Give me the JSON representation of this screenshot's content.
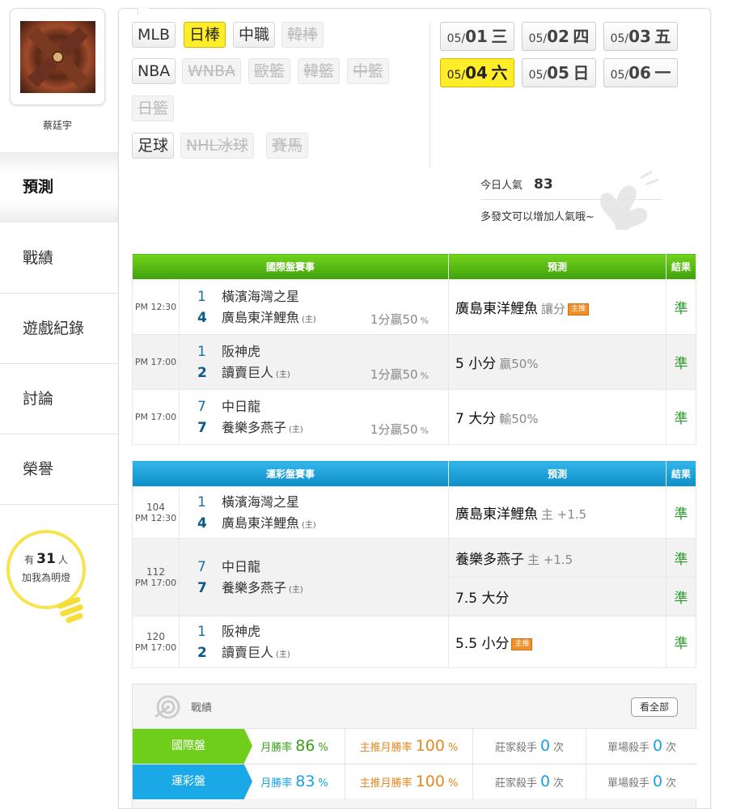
{
  "user": {
    "name": "蔡廷宇"
  },
  "nav": [
    {
      "label": "預測",
      "active": true
    },
    {
      "label": "戰績"
    },
    {
      "label": "遊戲紀錄"
    },
    {
      "label": "討論"
    },
    {
      "label": "榮譽"
    }
  ],
  "fans": {
    "prefix": "有",
    "count": "31",
    "suffix": "人",
    "cta": "加我為明燈"
  },
  "leagues": [
    {
      "label": "MLB"
    },
    {
      "label": "日棒",
      "state": "active"
    },
    {
      "label": "中職"
    },
    {
      "label": "韓棒",
      "state": "disabled"
    },
    {
      "label": "NBA"
    },
    {
      "label": "WNBA",
      "state": "disabled"
    },
    {
      "label": "歐籃",
      "state": "disabled"
    },
    {
      "label": "韓籃",
      "state": "disabled"
    },
    {
      "label": "中籃",
      "state": "disabled"
    },
    {
      "label": "日籃",
      "state": "disabled"
    },
    {
      "label": "足球"
    },
    {
      "label": "NHL冰球",
      "state": "disabled"
    },
    {
      "label": "賽馬",
      "state": "disabled"
    }
  ],
  "dates": [
    {
      "md": "05/",
      "d": "01",
      "wd": "三"
    },
    {
      "md": "05/",
      "d": "02",
      "wd": "四"
    },
    {
      "md": "05/",
      "d": "03",
      "wd": "五"
    },
    {
      "md": "05/",
      "d": "04",
      "wd": "六",
      "active": true
    },
    {
      "md": "05/",
      "d": "05",
      "wd": "日"
    },
    {
      "md": "05/",
      "d": "06",
      "wd": "一"
    }
  ],
  "popularity": {
    "label": "今日人氣",
    "value": "83",
    "message": "多發文可以增加人氣哦~"
  },
  "intl_table": {
    "headers": [
      "國際盤賽事",
      "預測",
      "結果"
    ],
    "rows": [
      {
        "time": "PM 12:30",
        "away": "橫濱海灣之星",
        "away_score": "1",
        "home": "廣島東洋鯉魚",
        "home_score": "4",
        "home_tag": "(主)",
        "odd": "1分贏50",
        "odd_unit": "%",
        "pred": "廣島東洋鯉魚",
        "pred_sub": "讓分",
        "pick": "主推",
        "result": "準"
      },
      {
        "time": "PM 17:00",
        "away": "阪神虎",
        "away_score": "1",
        "home": "讀賣巨人",
        "home_score": "2",
        "home_tag": "(主)",
        "odd": "1分贏50",
        "odd_unit": "%",
        "pred": "5 小分",
        "pred_sub": "贏50%",
        "result": "準"
      },
      {
        "time": "PM 17:00",
        "away": "中日龍",
        "away_score": "7",
        "home": "養樂多燕子",
        "home_score": "7",
        "home_tag": "(主)",
        "odd": "1分贏50",
        "odd_unit": "%",
        "pred": "7 大分",
        "pred_sub": "輸50%",
        "result": "準"
      }
    ]
  },
  "lottery_table": {
    "headers": [
      "運彩盤賽事",
      "預測",
      "結果"
    ],
    "rows": [
      {
        "no": "104",
        "time": "PM 12:30",
        "away": "橫濱海灣之星",
        "away_score": "1",
        "home": "廣島東洋鯉魚",
        "home_score": "4",
        "home_tag": "(主)",
        "preds": [
          {
            "text": "廣島東洋鯉魚",
            "sub": "主 +1.5",
            "result": "準"
          }
        ]
      },
      {
        "no": "112",
        "time": "PM 17:00",
        "away": "中日龍",
        "away_score": "7",
        "home": "養樂多燕子",
        "home_score": "7",
        "home_tag": "(主)",
        "preds": [
          {
            "text": "養樂多燕子",
            "sub": "主 +1.5",
            "result": "準"
          },
          {
            "text": "7.5 大分",
            "sub": "",
            "result": "準"
          }
        ]
      },
      {
        "no": "120",
        "time": "PM 17:00",
        "away": "阪神虎",
        "away_score": "1",
        "home": "讀賣巨人",
        "home_score": "2",
        "home_tag": "(主)",
        "preds": [
          {
            "text": "5.5 小分",
            "sub": "",
            "pick": "主推",
            "result": "準"
          }
        ]
      }
    ]
  },
  "record": {
    "title": "戰績",
    "view_all": "看全部",
    "rows": [
      {
        "label": "國際盤",
        "color": "#6fce1a",
        "monthly_label": "月勝率",
        "monthly": "86",
        "pick_label": "主推月勝率",
        "pick": "100",
        "unit": "%",
        "killer_label": "莊家殺手",
        "killer": "0",
        "single_label": "單場殺手",
        "single": "0",
        "count_unit": "次"
      },
      {
        "label": "運彩盤",
        "color": "#1aa8e6",
        "monthly_label": "月勝率",
        "monthly": "83",
        "pick_label": "主推月勝率",
        "pick": "100",
        "unit": "%",
        "killer_label": "莊家殺手",
        "killer": "0",
        "single_label": "單場殺手",
        "single": "0",
        "count_unit": "次"
      }
    ]
  }
}
